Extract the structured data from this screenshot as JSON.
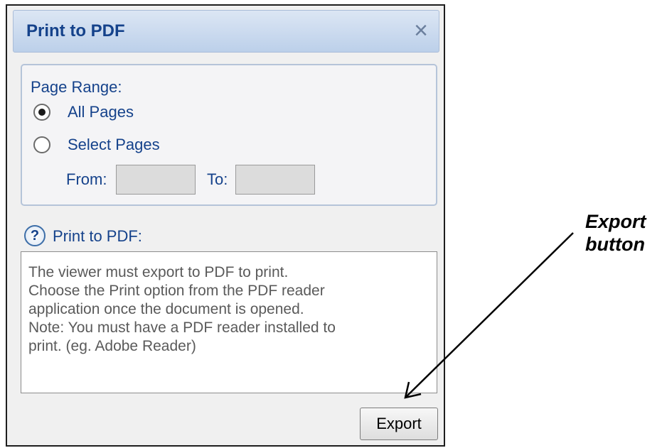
{
  "dialog": {
    "title": "Print to PDF",
    "close_glyph": "×"
  },
  "page_range": {
    "legend": "Page Range:",
    "options": [
      {
        "label": "All Pages",
        "selected": true
      },
      {
        "label": "Select Pages",
        "selected": false
      }
    ],
    "from_label": "From:",
    "from_value": "",
    "to_label": "To:",
    "to_value": ""
  },
  "help": {
    "icon_glyph": "?",
    "title": "Print to PDF:",
    "lines": [
      "The viewer must export to PDF to print.",
      "Choose the Print option from the PDF reader",
      "application once the document is opened.",
      "Note: You must have a PDF reader installed to",
      "print. (eg. Adobe Reader)"
    ]
  },
  "export_button": {
    "label": "Export"
  },
  "annotation": {
    "line1": "Export",
    "line2": "button"
  },
  "colors": {
    "accent": "#15428b",
    "title_gradient_top": "#dce6f4",
    "title_gradient_bottom": "#bcd0ea"
  }
}
